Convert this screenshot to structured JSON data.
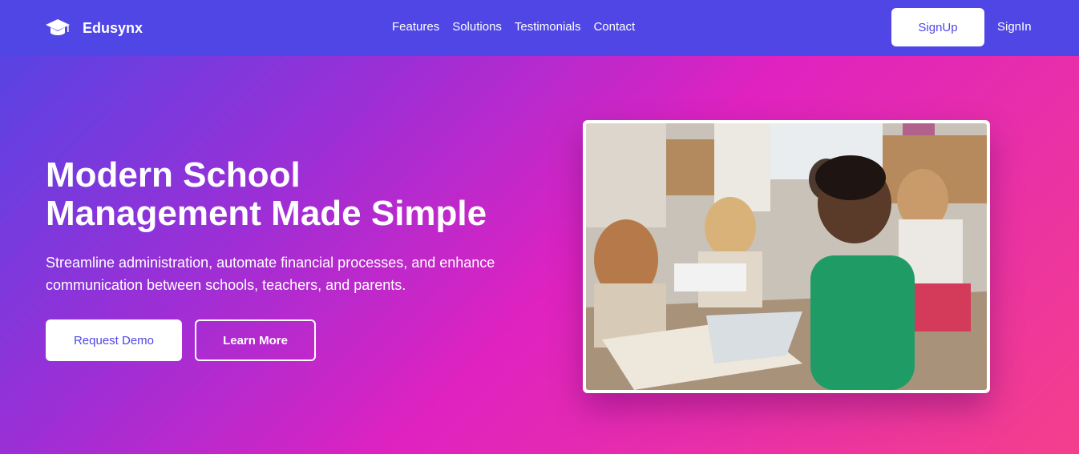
{
  "brand": {
    "name": "Edusynx",
    "icon": "graduation-cap-icon"
  },
  "nav": {
    "items": [
      {
        "label": "Features"
      },
      {
        "label": "Solutions"
      },
      {
        "label": "Testimonials"
      },
      {
        "label": "Contact"
      }
    ],
    "signup_label": "SignUp",
    "signin_label": "SignIn"
  },
  "hero": {
    "title_line1": "Modern School",
    "title_line2": "Management Made Simple",
    "subtitle": "Streamline administration, automate financial processes, and enhance communication between schools, teachers, and parents.",
    "primary_button": "Request Demo",
    "secondary_button": "Learn More"
  },
  "colors": {
    "primary": "#4f46e5",
    "gradient_mid": "#df22c0",
    "gradient_end": "#f43f8c",
    "white": "#ffffff"
  }
}
